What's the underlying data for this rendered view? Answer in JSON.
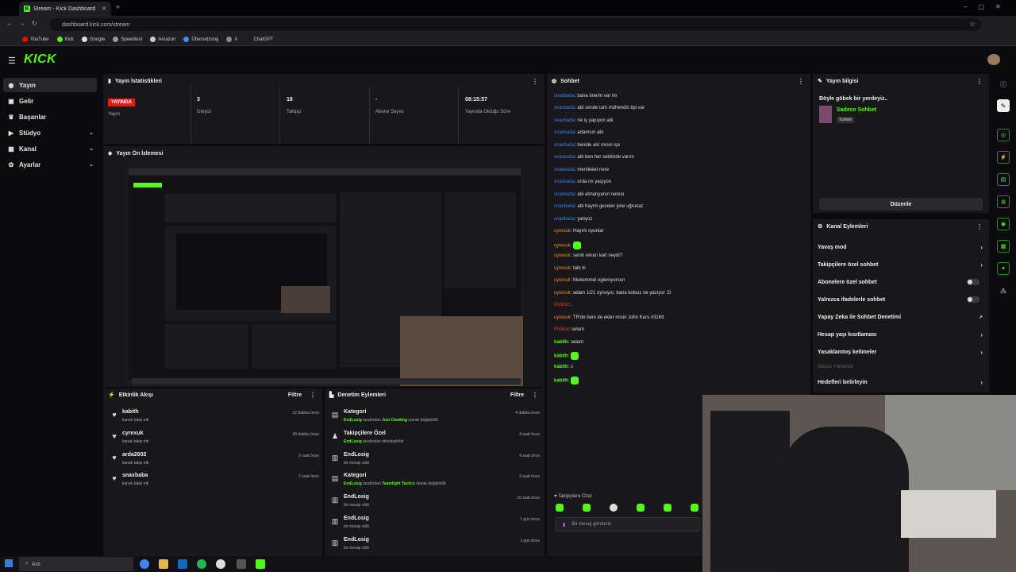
{
  "browser": {
    "tab_title": "Stream - Kick Dashboard",
    "url": "dashboard.kick.com/stream",
    "bookmarks": [
      "YouTube",
      "Kick",
      "Google",
      "Speedtest",
      "Amazon",
      "Übersetzung",
      "X",
      "ChatGPT"
    ]
  },
  "app": {
    "logo": "KICK"
  },
  "sidebar": {
    "items": [
      {
        "label": "Yayın",
        "icon": "broadcast-icon"
      },
      {
        "label": "Gelir",
        "icon": "wallet-icon"
      },
      {
        "label": "Başarılar",
        "icon": "trophy-icon"
      },
      {
        "label": "Stüdyo",
        "icon": "video-icon"
      },
      {
        "label": "Kanal",
        "icon": "grid-icon"
      },
      {
        "label": "Ayarlar",
        "icon": "gear-icon"
      }
    ]
  },
  "stats": {
    "title": "Yayın İstatistikleri",
    "live_badge": "YAYINDA",
    "items": [
      {
        "value": "",
        "label": "Yayın"
      },
      {
        "value": "3",
        "label": "İzleyici"
      },
      {
        "value": "18",
        "label": "Takipçi"
      },
      {
        "value": "-",
        "label": "Abone Sayısı"
      },
      {
        "value": "08:15:57",
        "label": "Yayında Olduğu Süre"
      }
    ]
  },
  "preview": {
    "title": "Yayın Ön İzlemesi"
  },
  "activity": {
    "title": "Etkinlik Akışı",
    "filter": "Filtre",
    "items": [
      {
        "name": "kabith",
        "sub": "kanalı takip etti",
        "time": "12 dakika önce"
      },
      {
        "name": "cyrexuk",
        "sub": "kanalı takip etti",
        "time": "49 dakika önce"
      },
      {
        "name": "arda2602",
        "sub": "kanalı takip etti",
        "time": "2 saat önce"
      },
      {
        "name": "snaxbaba",
        "sub": "kanalı takip etti",
        "time": "2 saat önce"
      }
    ]
  },
  "moderation": {
    "title": "Denetim Eylemleri",
    "filter": "Filtre",
    "items": [
      {
        "title": "Kategori",
        "actor": "EndLosig",
        "mid": " tarafından ",
        "highlight": "Just Chatting",
        "rest": " olarak değiştirildi",
        "time": "4 dakika önce"
      },
      {
        "title": "Takipçilere Özel",
        "actor": "EndLosig",
        "mid": " tarafından etkinleştirildi",
        "highlight": "",
        "rest": "",
        "time": "4 saat önce"
      },
      {
        "title": "EndLosig",
        "actor": "",
        "mid": "bir mesajı sildi",
        "highlight": "",
        "rest": "",
        "time": "4 saat önce"
      },
      {
        "title": "Kategori",
        "actor": "EndLosig",
        "mid": " tarafından ",
        "highlight": "Teamfight Tactics",
        "rest": " olarak değiştirildi",
        "time": "9 saat önce"
      },
      {
        "title": "EndLosig",
        "actor": "",
        "mid": "bir mesajı sildi",
        "highlight": "",
        "rest": "",
        "time": "10 saat önce"
      },
      {
        "title": "EndLosig",
        "actor": "",
        "mid": "bir mesajı sildi",
        "highlight": "",
        "rest": "",
        "time": "1 gün önce"
      },
      {
        "title": "EndLosig",
        "actor": "",
        "mid": "bir mesajı sildi",
        "highlight": "",
        "rest": "",
        "time": "1 gün önce"
      }
    ]
  },
  "chat": {
    "title": "Sohbet",
    "messages": [
      {
        "user": "snaxbaba",
        "color": "blue",
        "text": ": bana önerin var mı",
        "emote": false
      },
      {
        "user": "snaxbaba",
        "color": "blue",
        "text": ": abi sende tam mühendis tipi var",
        "emote": false
      },
      {
        "user": "snaxbaba",
        "color": "blue",
        "text": ": ne iş yapıyon abi",
        "emote": false
      },
      {
        "user": "snaxbaba",
        "color": "blue",
        "text": ": adamsın abi",
        "emote": false
      },
      {
        "user": "snaxbaba",
        "color": "blue",
        "text": ": benide alır mısın işe",
        "emote": false
      },
      {
        "user": "snaxbaba",
        "color": "blue",
        "text": ": abi ben her sektörde varım",
        "emote": false
      },
      {
        "user": "snaxbaba",
        "color": "blue",
        "text": ": memleket nere",
        "emote": false
      },
      {
        "user": "snaxbaba",
        "color": "blue",
        "text": ": orda mı yaşıyon",
        "emote": false
      },
      {
        "user": "snaxbaba",
        "color": "blue",
        "text": ": abi almanyanın neresi",
        "emote": false
      },
      {
        "user": "snaxbaba",
        "color": "blue",
        "text": ": abi hayırlı geceler yine uğrucaz",
        "emote": false
      },
      {
        "user": "snaxbaba",
        "color": "blue",
        "text": ": yatıyoz",
        "emote": false
      },
      {
        "user": "cyrexuk",
        "color": "orange",
        "text": ": Hayırlı oyunlar",
        "emote": false
      },
      {
        "user": "cyrexuk",
        "color": "orange",
        "text": ": ",
        "emote": true
      },
      {
        "user": "cyrexuk",
        "color": "orange",
        "text": ": senin ekran kart neydi?",
        "emote": false
      },
      {
        "user": "cyrexuk",
        "color": "orange",
        "text": ": tabi ki",
        "emote": false
      },
      {
        "user": "cyrexuk",
        "color": "orange",
        "text": ": Mukemmel eglenıyorsun",
        "emote": false
      },
      {
        "user": "cyrexuk",
        "color": "orange",
        "text": ": adam 1/21 oynuyor, bana kolsuz oe yazıyor :D",
        "emote": false
      },
      {
        "user": "Pirlidor",
        "color": "red",
        "text": ": .",
        "emote": false
      },
      {
        "user": "cyrexuk",
        "color": "orange",
        "text": ": TR'de beni de ekler misin John Kars #3169",
        "emote": false
      },
      {
        "user": "Pirlidor",
        "color": "red",
        "text": ": selam",
        "emote": false
      },
      {
        "user": "kabith",
        "color": "green",
        "text": ": selam",
        "emote": false
      },
      {
        "user": "kabith",
        "color": "green",
        "text": ": ",
        "emote": true
      },
      {
        "user": "kabith",
        "color": "green",
        "text": ": s",
        "emote": false
      },
      {
        "user": "kabith",
        "color": "green",
        "text": ": ",
        "emote": true
      }
    ],
    "followers_only": "Takipçilere Özel",
    "input_placeholder": "Bir mesaj gönderin"
  },
  "stream_info": {
    "title": "Yayın bilgisi",
    "stream_title": "Böyle göbek bir yerdeyiz..",
    "category": "Sadece Sohbet",
    "language": "Turkish",
    "edit": "Düzenle"
  },
  "channel_actions": {
    "title": "Kanal Eylemleri",
    "items": [
      {
        "label": "Yavaş mod",
        "control": "chevron"
      },
      {
        "label": "Takipçilere özel sohbet",
        "control": "chevron"
      },
      {
        "label": "Abonelere özel sohbet",
        "control": "toggle"
      },
      {
        "label": "Yalnızca ifadelerle sohbet",
        "control": "toggle"
      },
      {
        "label": "Yapay Zeka ile Sohbet Denetimi",
        "control": "external"
      },
      {
        "label": "Hesap yaşı kısıtlaması",
        "control": "chevron"
      },
      {
        "label": "Yasaklanmış kelimeler",
        "control": "chevron"
      },
      {
        "label": "İzleyici Yönlendir",
        "control": "none"
      },
      {
        "label": "Hedefleri belirleyin",
        "control": "chevron"
      }
    ]
  },
  "taskbar": {
    "search": "Ara"
  },
  "colors": {
    "accent": "#53fc18",
    "live": "#e91916",
    "panel": "#18181b"
  }
}
